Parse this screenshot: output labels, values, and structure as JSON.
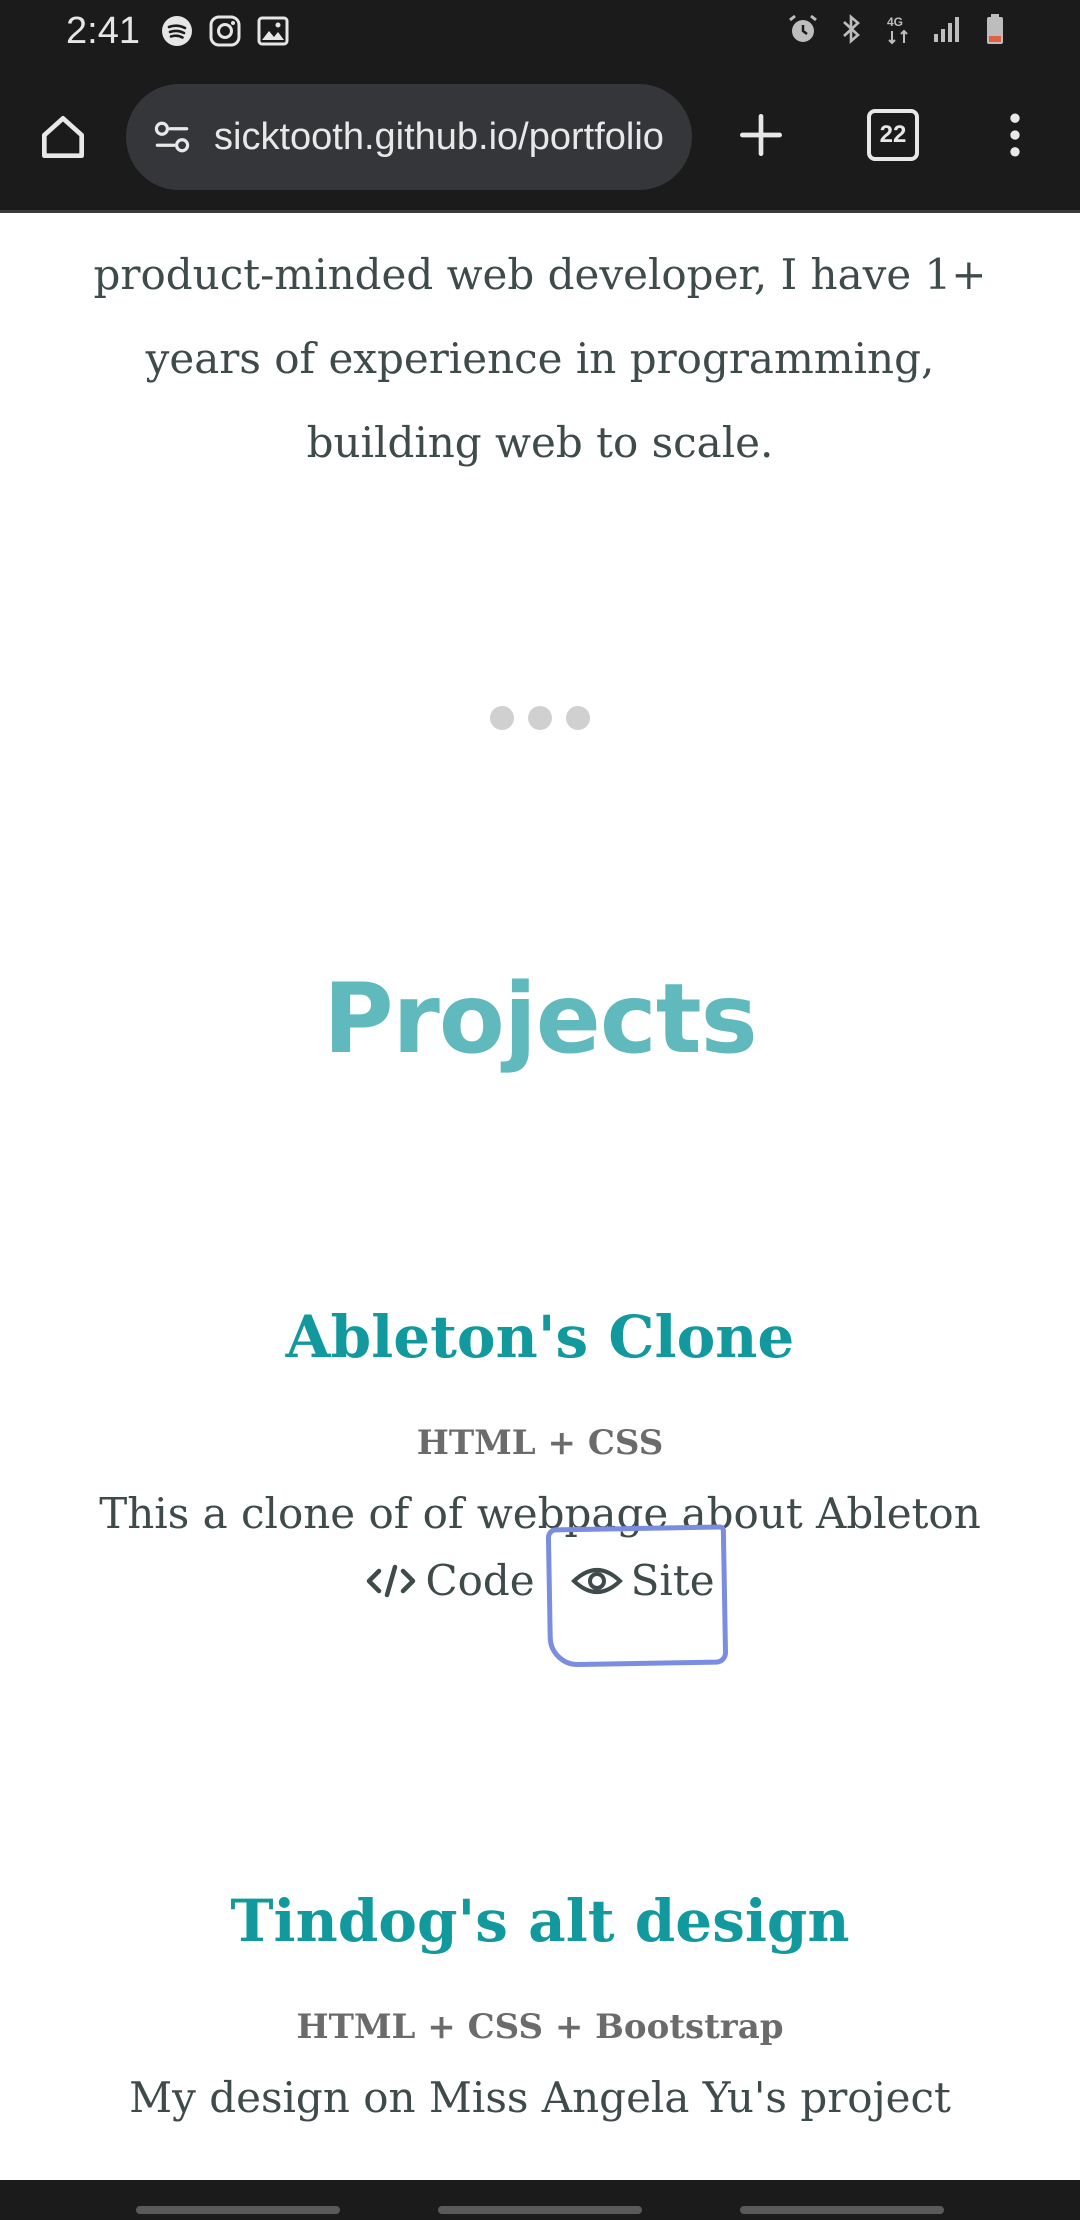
{
  "status_bar": {
    "time": "2:41",
    "left_icons": [
      "spotify-icon",
      "instagram-icon",
      "gallery-icon"
    ],
    "right_icons": [
      "alarm-icon",
      "bluetooth-icon",
      "network-4g-icon",
      "signal-icon",
      "battery-icon"
    ],
    "network_label": "4G"
  },
  "browser": {
    "url": "sicktooth.github.io/portfolio",
    "tab_count": "22"
  },
  "intro": {
    "text": "product-minded web developer, I have 1+ years of experience in programming, building web to scale."
  },
  "projects_section": {
    "title": "Projects"
  },
  "projects": [
    {
      "title": "Ableton's Clone",
      "tech": "HTML + CSS",
      "description": "This a clone of of webpage about Ableton",
      "code_label": "Code",
      "site_label": "Site"
    },
    {
      "title": "Tindog's alt design",
      "tech": "HTML + CSS + Bootstrap",
      "description": "My design on Miss Angela Yu's project"
    }
  ],
  "colors": {
    "accent": "#11999e",
    "section_title": "#5fb9bd",
    "highlight": "#7b8de0"
  }
}
